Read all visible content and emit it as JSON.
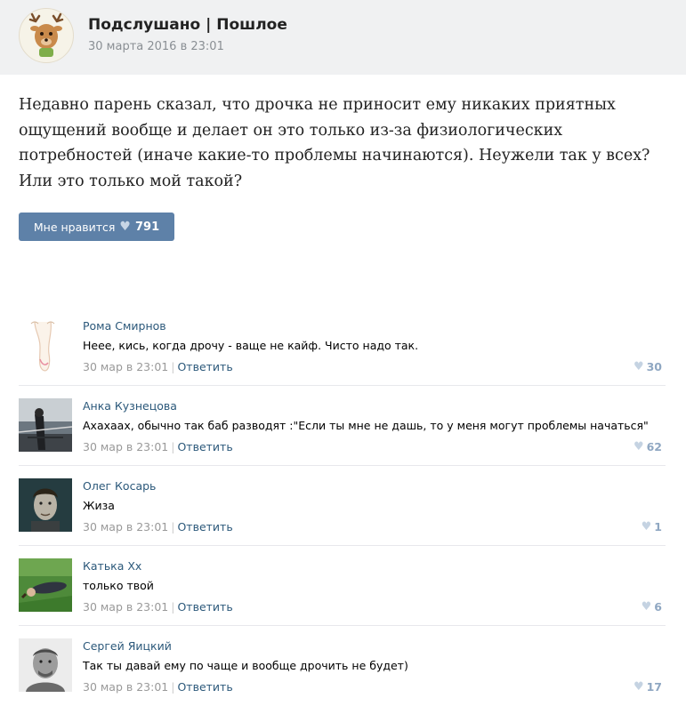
{
  "group": {
    "name": "Подслушано | Пошлое",
    "date": "30 марта 2016 в 23:01"
  },
  "post": {
    "text": "Недавно парень сказал, что дрочка не приносит ему никаких приятных ощущений вообще и делает он это только из-за физиологических потребностей (иначе какие-то проблемы начинаются). Неужели так у всех? Или это только мой такой?",
    "like_label": "Мне нравится",
    "like_count": "791"
  },
  "icons": {
    "heart": "♥"
  },
  "comments": [
    {
      "author": "Рома Смирнов",
      "text": "Неее, кись, когда дрочу - ваще не кайф. Чисто надо так.",
      "date": "30 мар в 23:01",
      "reply": "Ответить",
      "likes": "30"
    },
    {
      "author": "Анка Кузнецова",
      "text": "Ахахаах, обычно так баб разводят :\"Если ты мне не дашь, то у меня могут проблемы начаться\"",
      "date": "30 мар в 23:01",
      "reply": "Ответить",
      "likes": "62"
    },
    {
      "author": "Олег Косарь",
      "text": "Жиза",
      "date": "30 мар в 23:01",
      "reply": "Ответить",
      "likes": "1"
    },
    {
      "author": "Катька Хх",
      "text": "только твой",
      "date": "30 мар в 23:01",
      "reply": "Ответить",
      "likes": "6"
    },
    {
      "author": "Сергей Яицкий",
      "text": "Так ты давай ему по чаще и вообще дрочить не будет)",
      "date": "30 мар в 23:01",
      "reply": "Ответить",
      "likes": "17"
    }
  ]
}
